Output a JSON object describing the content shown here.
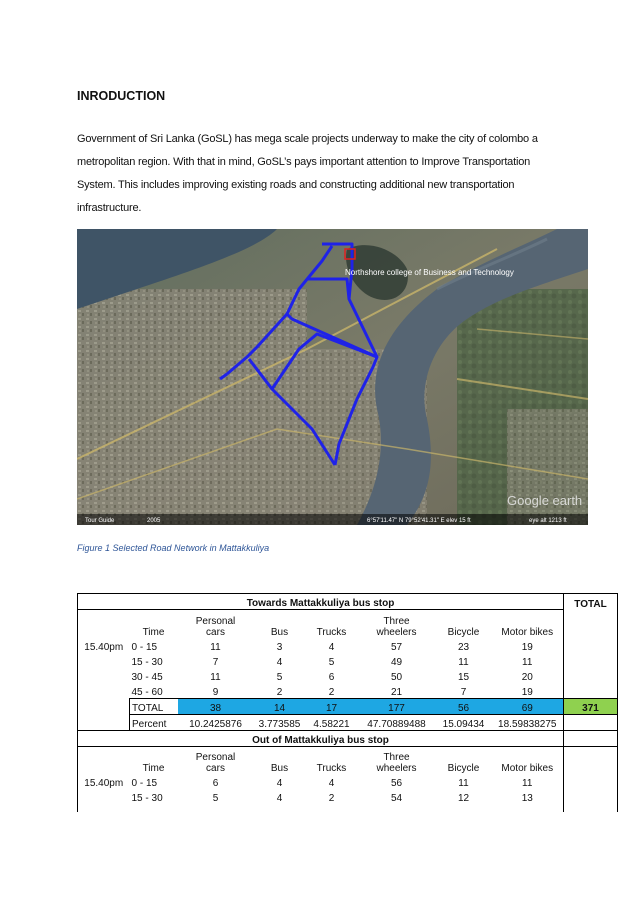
{
  "heading": "INRODUCTION",
  "intro_lines": [
    "Government of Sri Lanka (GoSL) has mega scale projects underway to make the city of colombo a",
    "metropolitan region. With that in mind, GoSL’s pays important attention to Improve Transportation",
    "System. This includes improving existing roads and constructing additional new transportation",
    "infrastructure."
  ],
  "map": {
    "label_college": "Northshore college of Business and Technology",
    "watermark": "Google earth",
    "tour_guide": "Tour Guide",
    "year": "2005",
    "coords": "6°57'11.47\" N  79°52'41.31\" E  elev  15 ft",
    "eye_alt": "eye alt 1213 ft",
    "route_color": "#1f22e8"
  },
  "caption": "Figure 1 Selected Road Network in Mattakkuliya",
  "table": {
    "towards_title": "Towards Mattakkuliya bus stop",
    "total_header": "TOTAL",
    "out_title": "Out of Mattakkuliya bus stop",
    "col_time": "Time",
    "col_cars_1": "Personal",
    "col_cars_2": "cars",
    "col_bus": "Bus",
    "col_trucks": "Trucks",
    "col_three_1": "Three",
    "col_three_2": "wheelers",
    "col_bicycle": "Bicycle",
    "col_motor": "Motor bikes",
    "time_label": "15.40pm",
    "towards_rows": [
      [
        "0 - 15",
        "11",
        "3",
        "4",
        "57",
        "23",
        "19"
      ],
      [
        "15 - 30",
        "7",
        "4",
        "5",
        "49",
        "11",
        "11"
      ],
      [
        "30 - 45",
        "11",
        "5",
        "6",
        "50",
        "15",
        "20"
      ],
      [
        "45 - 60",
        "9",
        "2",
        "2",
        "21",
        "7",
        "19"
      ]
    ],
    "total_row": [
      "TOTAL",
      "38",
      "14",
      "17",
      "177",
      "56",
      "69"
    ],
    "grand_total": "371",
    "percent_row": [
      "Percent",
      "10.2425876",
      "3.773585",
      "4.58221",
      "47.70889488",
      "15.09434",
      "18.59838275"
    ],
    "out_rows": [
      [
        "0 - 15",
        "6",
        "4",
        "4",
        "56",
        "11",
        "11"
      ],
      [
        "15 - 30",
        "5",
        "4",
        "2",
        "54",
        "12",
        "13"
      ]
    ],
    "highlight_blue": "#1ea7e3",
    "highlight_green": "#8fd14f"
  }
}
